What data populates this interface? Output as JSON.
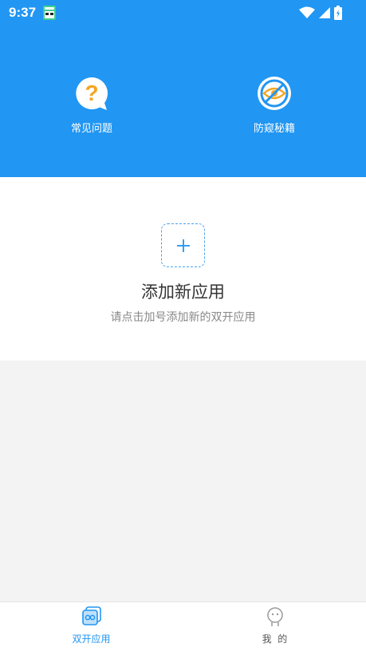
{
  "status_bar": {
    "time": "9:37",
    "icons": [
      "app-notification-icon",
      "wifi-icon",
      "signal-icon",
      "battery-icon"
    ]
  },
  "header": {
    "features": [
      {
        "label": "常见问题",
        "icon": "question-bubble-icon"
      },
      {
        "label": "防窥秘籍",
        "icon": "eye-slash-icon"
      }
    ]
  },
  "add_app": {
    "title": "添加新应用",
    "subtitle": "请点击加号添加新的双开应用",
    "icon": "plus-icon"
  },
  "bottom_nav": {
    "items": [
      {
        "label": "双开应用",
        "icon": "dual-app-icon",
        "active": true
      },
      {
        "label": "我  的",
        "icon": "profile-icon",
        "active": false
      }
    ]
  },
  "colors": {
    "primary": "#2196f3",
    "accent_orange": "#f5a623",
    "nav_active": "#2196f3",
    "nav_inactive": "#777777"
  }
}
